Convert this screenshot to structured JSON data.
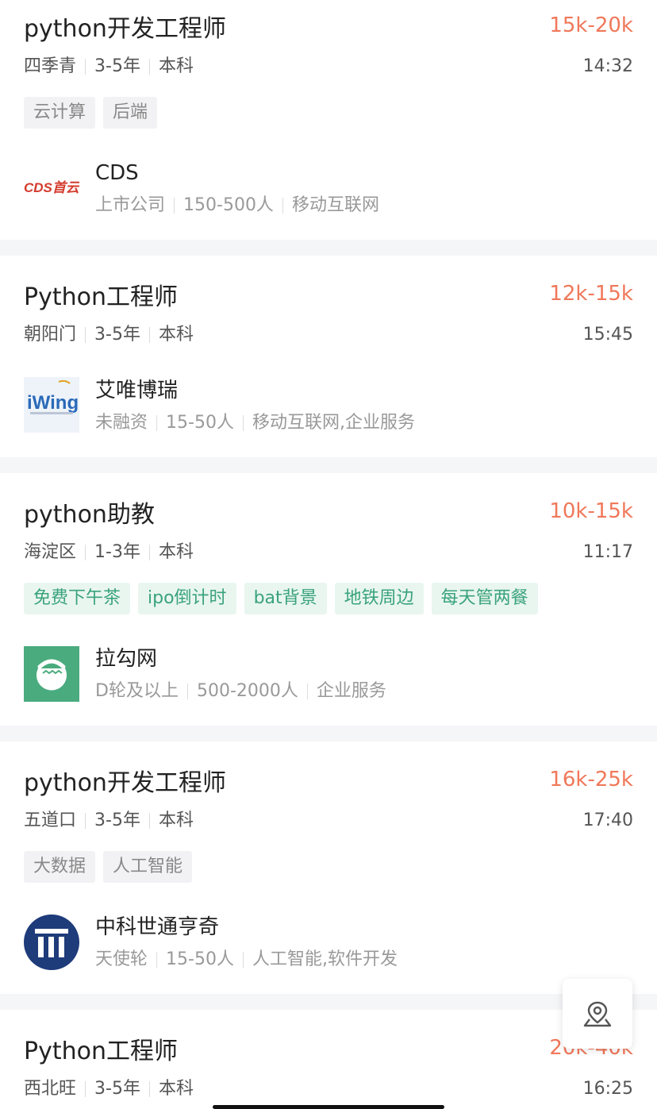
{
  "jobs": [
    {
      "title": "python开发工程师",
      "salary": "15k-20k",
      "location": "四季青",
      "experience": "3-5年",
      "education": "本科",
      "time": "14:32",
      "tags": [
        "云计算",
        "后端"
      ],
      "company": {
        "name": "CDS",
        "logo_text": "CDS首云",
        "stage": "上市公司",
        "size": "150-500人",
        "industry": "移动互联网"
      }
    },
    {
      "title": "Python工程师",
      "salary": "12k-15k",
      "location": "朝阳门",
      "experience": "3-5年",
      "education": "本科",
      "time": "15:45",
      "tags": [],
      "company": {
        "name": "艾唯博瑞",
        "logo_text": "iWing",
        "stage": "未融资",
        "size": "15-50人",
        "industry": "移动互联网,企业服务"
      }
    },
    {
      "title": "python助教",
      "salary": "10k-15k",
      "location": "海淀区",
      "experience": "1-3年",
      "education": "本科",
      "time": "11:17",
      "tags": [
        "免费下午茶",
        "ipo倒计时",
        "bat背景",
        "地铁周边",
        "每天管两餐"
      ],
      "company": {
        "name": "拉勾网",
        "stage": "D轮及以上",
        "size": "500-2000人",
        "industry": "企业服务"
      }
    },
    {
      "title": "python开发工程师",
      "salary": "16k-25k",
      "location": "五道口",
      "experience": "3-5年",
      "education": "本科",
      "time": "17:40",
      "tags": [
        "大数据",
        "人工智能"
      ],
      "company": {
        "name": "中科世通亨奇",
        "stage": "天使轮",
        "size": "15-50人",
        "industry": "人工智能,软件开发"
      }
    },
    {
      "title": "Python工程师",
      "salary": "20k-40k",
      "location": "西北旺",
      "experience": "3-5年",
      "education": "本科",
      "time": "16:25",
      "tags": []
    }
  ],
  "fab": {
    "icon": "map-pin-icon"
  },
  "colors": {
    "salary": "#f0785a",
    "benefit_tag": "#3aa37b",
    "lagou_green": "#4aab7e",
    "zhongke_blue": "#1e3b7a"
  }
}
